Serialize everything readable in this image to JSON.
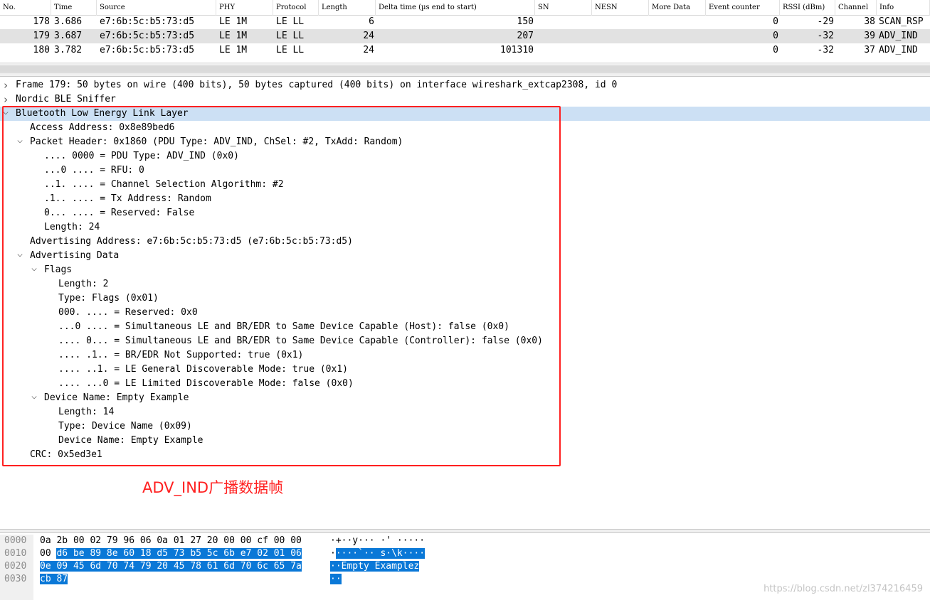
{
  "packet_list": {
    "columns": [
      "No.",
      "Time",
      "Source",
      "PHY",
      "Protocol",
      "Length",
      "Delta time (µs end to start)",
      "SN",
      "NESN",
      "More Data",
      "Event counter",
      "RSSI (dBm)",
      "Channel",
      "Info"
    ],
    "rows": [
      {
        "no": "178",
        "time": "3.686",
        "source": "e7:6b:5c:b5:73:d5",
        "phy": "LE 1M",
        "protocol": "LE LL",
        "length": "6",
        "delta": "150",
        "event": "0",
        "rssi": "-29",
        "channel": "38",
        "info": "SCAN_RSP",
        "selected": false
      },
      {
        "no": "179",
        "time": "3.687",
        "source": "e7:6b:5c:b5:73:d5",
        "phy": "LE 1M",
        "protocol": "LE LL",
        "length": "24",
        "delta": "207",
        "event": "0",
        "rssi": "-32",
        "channel": "39",
        "info": "ADV_IND",
        "selected": true
      },
      {
        "no": "180",
        "time": "3.782",
        "source": "e7:6b:5c:b5:73:d5",
        "phy": "LE 1M",
        "protocol": "LE LL",
        "length": "24",
        "delta": "101310",
        "event": "0",
        "rssi": "-32",
        "channel": "37",
        "info": "ADV_IND",
        "selected": false
      }
    ]
  },
  "detail_tree": [
    {
      "level": 0,
      "state": "collapsed",
      "text": "Frame 179: 50 bytes on wire (400 bits), 50 bytes captured (400 bits) on interface wireshark_extcap2308, id 0"
    },
    {
      "level": 0,
      "state": "collapsed",
      "text": "Nordic BLE Sniffer"
    },
    {
      "level": 0,
      "state": "expanded",
      "text": "Bluetooth Low Energy Link Layer",
      "selected": true
    },
    {
      "level": 1,
      "state": "leaf",
      "text": "Access Address: 0x8e89bed6"
    },
    {
      "level": 1,
      "state": "expanded",
      "text": "Packet Header: 0x1860 (PDU Type: ADV_IND, ChSel: #2, TxAdd: Random)"
    },
    {
      "level": 2,
      "state": "leaf",
      "text": ".... 0000 = PDU Type: ADV_IND (0x0)"
    },
    {
      "level": 2,
      "state": "leaf",
      "text": "...0 .... = RFU: 0"
    },
    {
      "level": 2,
      "state": "leaf",
      "text": "..1. .... = Channel Selection Algorithm: #2"
    },
    {
      "level": 2,
      "state": "leaf",
      "text": ".1.. .... = Tx Address: Random"
    },
    {
      "level": 2,
      "state": "leaf",
      "text": "0... .... = Reserved: False"
    },
    {
      "level": 2,
      "state": "leaf",
      "text": "Length: 24"
    },
    {
      "level": 1,
      "state": "leaf",
      "text": "Advertising Address: e7:6b:5c:b5:73:d5 (e7:6b:5c:b5:73:d5)"
    },
    {
      "level": 1,
      "state": "expanded",
      "text": "Advertising Data"
    },
    {
      "level": 2,
      "state": "expanded",
      "text": "Flags"
    },
    {
      "level": 3,
      "state": "leaf",
      "text": "Length: 2"
    },
    {
      "level": 3,
      "state": "leaf",
      "text": "Type: Flags (0x01)"
    },
    {
      "level": 3,
      "state": "leaf",
      "text": "000. .... = Reserved: 0x0"
    },
    {
      "level": 3,
      "state": "leaf",
      "text": "...0 .... = Simultaneous LE and BR/EDR to Same Device Capable (Host): false (0x0)"
    },
    {
      "level": 3,
      "state": "leaf",
      "text": ".... 0... = Simultaneous LE and BR/EDR to Same Device Capable (Controller): false (0x0)"
    },
    {
      "level": 3,
      "state": "leaf",
      "text": ".... .1.. = BR/EDR Not Supported: true (0x1)"
    },
    {
      "level": 3,
      "state": "leaf",
      "text": ".... ..1. = LE General Discoverable Mode: true (0x1)"
    },
    {
      "level": 3,
      "state": "leaf",
      "text": ".... ...0 = LE Limited Discoverable Mode: false (0x0)"
    },
    {
      "level": 2,
      "state": "expanded",
      "text": "Device Name: Empty Example"
    },
    {
      "level": 3,
      "state": "leaf",
      "text": "Length: 14"
    },
    {
      "level": 3,
      "state": "leaf",
      "text": "Type: Device Name (0x09)"
    },
    {
      "level": 3,
      "state": "leaf",
      "text": "Device Name: Empty Example"
    },
    {
      "level": 1,
      "state": "leaf",
      "text": "CRC: 0x5ed3e1"
    }
  ],
  "annotation": "ADV_IND广播数据帧",
  "bytes_pane": {
    "rows": [
      {
        "offset": "0000",
        "hex_plain": "0a 2b 00 02 79 96 06 0a  01 27 20 00 00 cf 00 00",
        "hex_hl": "",
        "ascii_plain": "·+··y··· ·' ·····",
        "ascii_hl": ""
      },
      {
        "offset": "0010",
        "hex_plain": "00 ",
        "hex_hl": "d6 be 89 8e 60 18 d5  73 b5 5c 6b e7 02 01 06",
        "ascii_plain": "·",
        "ascii_hl": "····`·· s·\\k····"
      },
      {
        "offset": "0020",
        "hex_plain": "",
        "hex_hl": "0e 09 45 6d 70 74 79 20  45 78 61 6d 70 6c 65 7a",
        "ascii_plain": "",
        "ascii_hl": "··Empty  Examplez"
      },
      {
        "offset": "0030",
        "hex_plain": "",
        "hex_hl": "cb 87",
        "ascii_plain": "",
        "ascii_hl": "··"
      }
    ]
  },
  "watermark": "https://blog.csdn.net/zl374216459",
  "colors": {
    "selection_blue": "#cce0f4",
    "byte_highlight": "#0a78d7",
    "annotation_red": "#ff2020",
    "row_gray": "#e2e2e2"
  }
}
